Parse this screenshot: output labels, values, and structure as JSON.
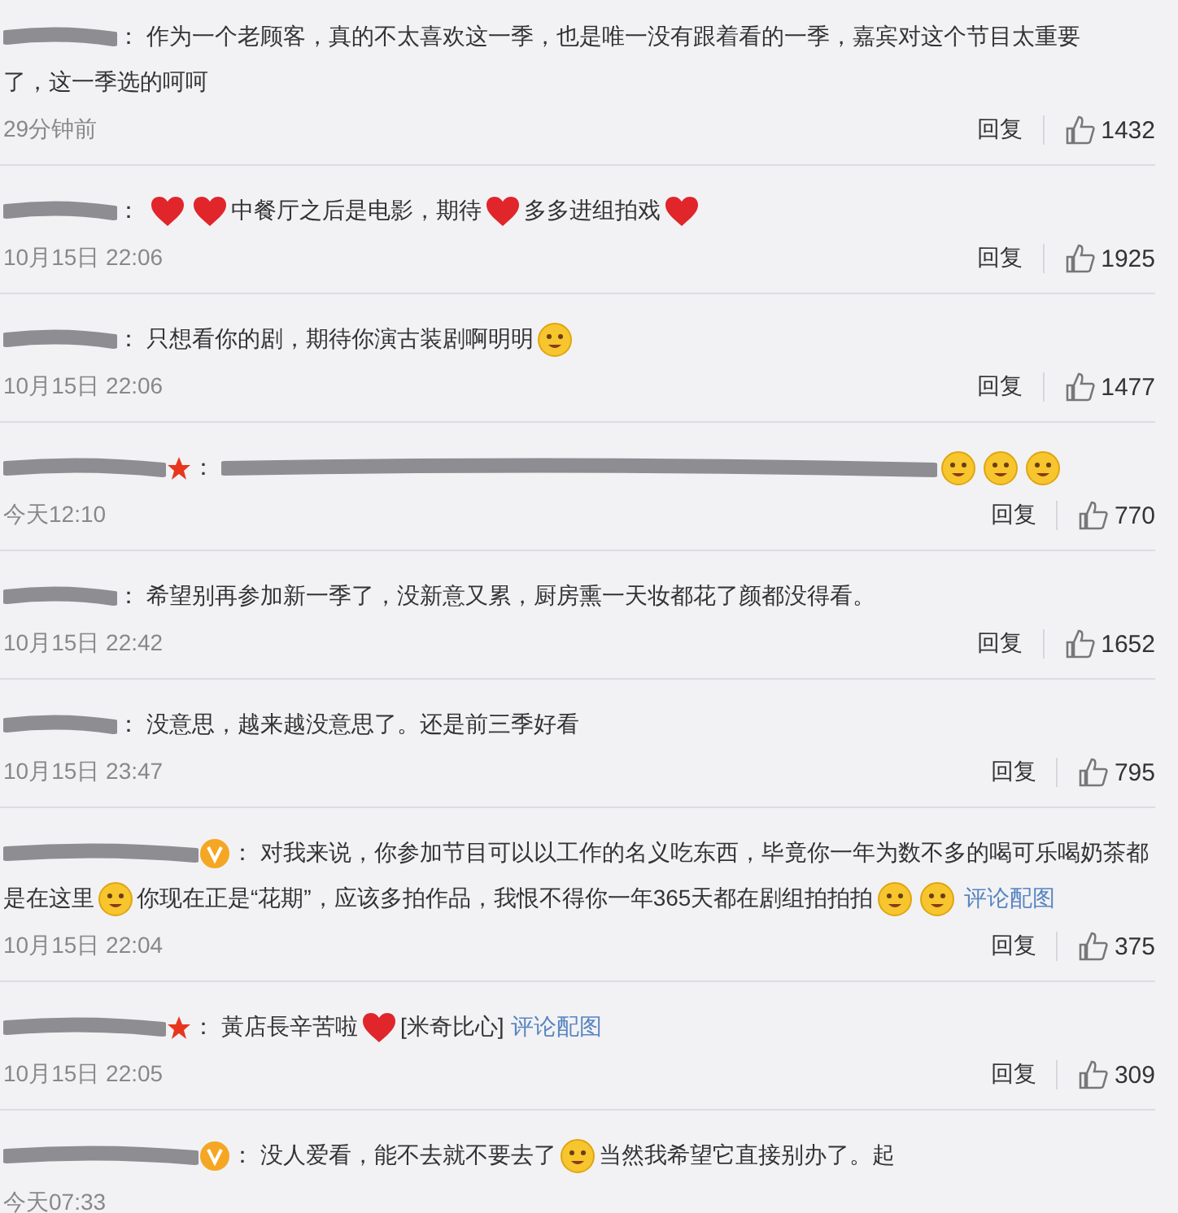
{
  "comments": [
    {
      "star_badge": false,
      "verified_badge": false,
      "colon": "：",
      "lines": [
        [
          {
            "kind": "text",
            "text": "作为一个老顾客，真的不太喜欢这一季，也是唯一没有跟着看的一季，嘉宾对这个节目太重要"
          }
        ],
        [
          {
            "kind": "text",
            "text": "了，这一季选的呵呵"
          }
        ]
      ],
      "time": "29分钟前",
      "reply": "回复",
      "likes": "1432"
    },
    {
      "star_badge": false,
      "verified_badge": false,
      "colon": "：",
      "lines": [
        [
          {
            "kind": "heart"
          },
          {
            "kind": "heart"
          },
          {
            "kind": "text",
            "text": "中餐厅之后是电影，期待"
          },
          {
            "kind": "heart"
          },
          {
            "kind": "text",
            "text": "多多进组拍戏"
          },
          {
            "kind": "heart"
          }
        ]
      ],
      "time": "10月15日 22:06",
      "reply": "回复",
      "likes": "1925"
    },
    {
      "star_badge": false,
      "verified_badge": false,
      "colon": "：",
      "lines": [
        [
          {
            "kind": "text",
            "text": "只想看你的剧，期待你演古装剧啊明明"
          },
          {
            "kind": "face"
          }
        ]
      ],
      "time": "10月15日 22:06",
      "reply": "回复",
      "likes": "1477"
    },
    {
      "star_badge": true,
      "verified_badge": false,
      "colon": "：",
      "lines": [
        [
          {
            "kind": "redaction"
          },
          {
            "kind": "face"
          },
          {
            "kind": "face"
          },
          {
            "kind": "face"
          }
        ]
      ],
      "time": "今天12:10",
      "reply": "回复",
      "likes": "770"
    },
    {
      "star_badge": false,
      "verified_badge": false,
      "colon": "：",
      "lines": [
        [
          {
            "kind": "text",
            "text": "希望别再参加新一季了，没新意又累，厨房熏一天妆都花了颜都没得看。"
          }
        ]
      ],
      "time": "10月15日 22:42",
      "reply": "回复",
      "likes": "1652"
    },
    {
      "star_badge": false,
      "verified_badge": false,
      "colon": "：",
      "lines": [
        [
          {
            "kind": "text",
            "text": "没意思，越来越没意思了。还是前三季好看"
          }
        ]
      ],
      "time": "10月15日 23:47",
      "reply": "回复",
      "likes": "795"
    },
    {
      "star_badge": false,
      "verified_badge": true,
      "colon": "：",
      "lines": [
        [
          {
            "kind": "text",
            "text": "对我来说，你参加节目可以以工作的名义吃东西，毕竟你一年为数不多的喝可乐喝奶茶都"
          }
        ],
        [
          {
            "kind": "text",
            "text": "是在这里"
          },
          {
            "kind": "face"
          },
          {
            "kind": "text",
            "text": "你现在正是“花期”，应该多拍作品，我恨不得你一年365天都在剧组拍拍拍"
          },
          {
            "kind": "face"
          },
          {
            "kind": "face"
          },
          {
            "kind": "link",
            "text": "评论配图"
          }
        ]
      ],
      "time": "10月15日 22:04",
      "reply": "回复",
      "likes": "375"
    },
    {
      "star_badge": true,
      "verified_badge": false,
      "colon": "：",
      "lines": [
        [
          {
            "kind": "text",
            "text": "黃店長辛苦啦"
          },
          {
            "kind": "heart"
          },
          {
            "kind": "text",
            "text": "[米奇比心]"
          },
          {
            "kind": "link",
            "text": "评论配图"
          }
        ]
      ],
      "time": "10月15日 22:05",
      "reply": "回复",
      "likes": "309"
    },
    {
      "star_badge": false,
      "verified_badge": true,
      "colon": "：",
      "lines": [
        [
          {
            "kind": "text",
            "text": "没人爱看，能不去就不要去了"
          },
          {
            "kind": "face"
          },
          {
            "kind": "text",
            "text": "当然我希望它直接别办了。起"
          }
        ]
      ],
      "time": "今天07:33"
    }
  ]
}
